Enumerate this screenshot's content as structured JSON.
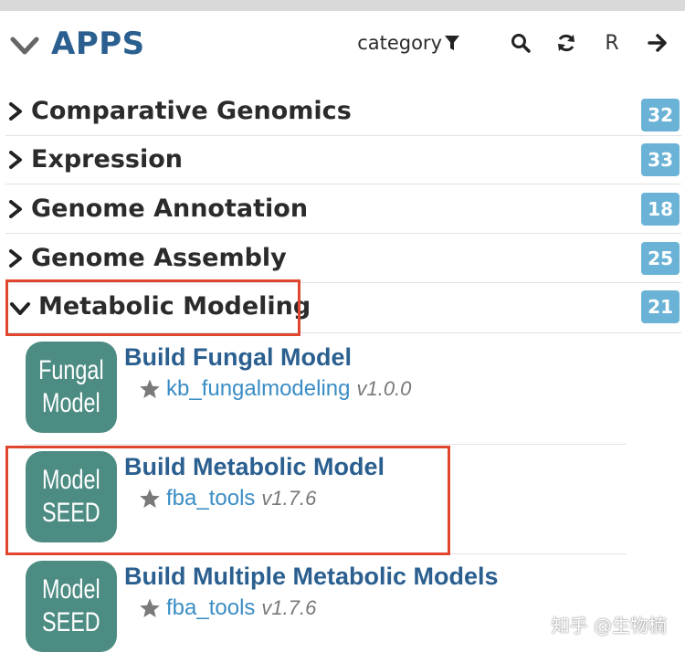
{
  "header": {
    "title": "APPS",
    "category_label": "category",
    "r_label": "R"
  },
  "categories": [
    {
      "label": "Comparative Genomics",
      "count": "32",
      "expanded": false
    },
    {
      "label": "Expression",
      "count": "33",
      "expanded": false
    },
    {
      "label": "Genome Annotation",
      "count": "18",
      "expanded": false
    },
    {
      "label": "Genome Assembly",
      "count": "25",
      "expanded": false
    },
    {
      "label": "Metabolic Modeling",
      "count": "21",
      "expanded": true
    }
  ],
  "apps": [
    {
      "logo_line1": "Fungal",
      "logo_line2": "Model",
      "name": "Build Fungal Model",
      "module": "kb_fungalmodeling",
      "version": "v1.0.0",
      "logo_color": "#4c8c82"
    },
    {
      "logo_line1": "Model",
      "logo_line2": "SEED",
      "name": "Build Metabolic Model",
      "module": "fba_tools",
      "version": "v1.7.6",
      "logo_color": "#4c8c82"
    },
    {
      "logo_line1": "Model",
      "logo_line2": "SEED",
      "name": "Build Multiple Metabolic Models",
      "module": "fba_tools",
      "version": "v1.7.6",
      "logo_color": "#4c8c82"
    }
  ],
  "icons": {
    "collapse": "chevron-down-icon",
    "filter": "filter-icon",
    "search": "search-icon",
    "refresh": "refresh-icon",
    "next": "arrow-right-icon",
    "star": "star-icon"
  },
  "colors": {
    "title_blue": "#2a5f8f",
    "count_badge": "#6bb3d6",
    "logo_teal": "#4c8c82",
    "module_link": "#3a8dc5",
    "highlight_red": "#e0452e"
  },
  "watermark": "知乎 @生物楠"
}
